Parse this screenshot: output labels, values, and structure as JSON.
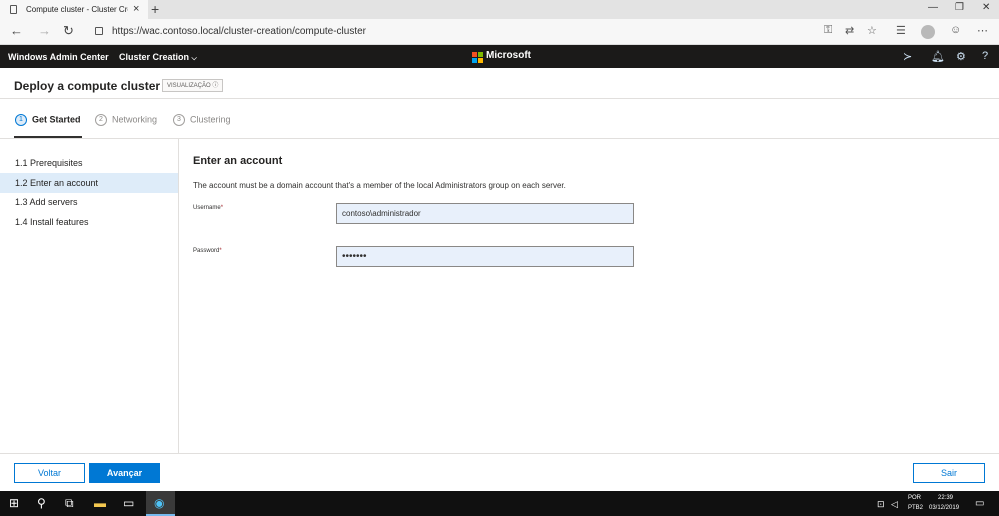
{
  "browser": {
    "tab_title": "Compute cluster - Cluster Creation",
    "tab_close": "×",
    "new_tab": "+",
    "url": "https://wac.contoso.local/cluster-creation/compute-cluster"
  },
  "header": {
    "brand": "Windows Admin Center",
    "tool_menu": "Cluster Creation",
    "center_brand": "Microsoft",
    "ms_colors": [
      "#f25022",
      "#7fba00",
      "#00a4ef",
      "#ffb900"
    ]
  },
  "page": {
    "title": "Deploy a compute cluster",
    "badge": "VISUALIZAÇÃO ⓘ"
  },
  "steps": [
    {
      "num": "1",
      "label": "Get Started",
      "active": true
    },
    {
      "num": "2",
      "label": "Networking",
      "active": false
    },
    {
      "num": "3",
      "label": "Clustering",
      "active": false
    }
  ],
  "leftnav": [
    {
      "label": "1.1  Prerequisites",
      "selected": false
    },
    {
      "label": "1.2  Enter an account",
      "selected": true
    },
    {
      "label": "1.3  Add servers",
      "selected": false
    },
    {
      "label": "1.4  Install features",
      "selected": false
    }
  ],
  "main": {
    "heading": "Enter an account",
    "description": "The account must be a domain account that's a member of the local Administrators group on each server.",
    "username_label": "Username",
    "username_value": "contoso\\administrador",
    "password_label": "Password",
    "password_value": "•••••••",
    "required_marker": "*"
  },
  "footer": {
    "back": "Voltar",
    "next": "Avançar",
    "exit": "Sair"
  },
  "taskbar": {
    "lang": "POR",
    "layout": "PTB2",
    "time": "22:39",
    "date": "03/12/2019"
  },
  "colors": {
    "accent": "#0078d4",
    "header_bg": "#1b1a19",
    "selected_bg": "#deecf9"
  }
}
